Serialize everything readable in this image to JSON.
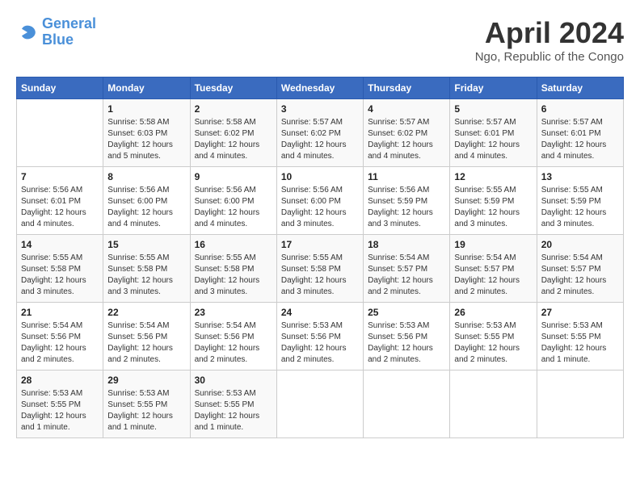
{
  "logo": {
    "line1": "General",
    "line2": "Blue"
  },
  "title": "April 2024",
  "subtitle": "Ngo, Republic of the Congo",
  "days_of_week": [
    "Sunday",
    "Monday",
    "Tuesday",
    "Wednesday",
    "Thursday",
    "Friday",
    "Saturday"
  ],
  "weeks": [
    [
      {
        "num": "",
        "detail": ""
      },
      {
        "num": "1",
        "detail": "Sunrise: 5:58 AM\nSunset: 6:03 PM\nDaylight: 12 hours\nand 5 minutes."
      },
      {
        "num": "2",
        "detail": "Sunrise: 5:58 AM\nSunset: 6:02 PM\nDaylight: 12 hours\nand 4 minutes."
      },
      {
        "num": "3",
        "detail": "Sunrise: 5:57 AM\nSunset: 6:02 PM\nDaylight: 12 hours\nand 4 minutes."
      },
      {
        "num": "4",
        "detail": "Sunrise: 5:57 AM\nSunset: 6:02 PM\nDaylight: 12 hours\nand 4 minutes."
      },
      {
        "num": "5",
        "detail": "Sunrise: 5:57 AM\nSunset: 6:01 PM\nDaylight: 12 hours\nand 4 minutes."
      },
      {
        "num": "6",
        "detail": "Sunrise: 5:57 AM\nSunset: 6:01 PM\nDaylight: 12 hours\nand 4 minutes."
      }
    ],
    [
      {
        "num": "7",
        "detail": "Sunrise: 5:56 AM\nSunset: 6:01 PM\nDaylight: 12 hours\nand 4 minutes."
      },
      {
        "num": "8",
        "detail": "Sunrise: 5:56 AM\nSunset: 6:00 PM\nDaylight: 12 hours\nand 4 minutes."
      },
      {
        "num": "9",
        "detail": "Sunrise: 5:56 AM\nSunset: 6:00 PM\nDaylight: 12 hours\nand 4 minutes."
      },
      {
        "num": "10",
        "detail": "Sunrise: 5:56 AM\nSunset: 6:00 PM\nDaylight: 12 hours\nand 3 minutes."
      },
      {
        "num": "11",
        "detail": "Sunrise: 5:56 AM\nSunset: 5:59 PM\nDaylight: 12 hours\nand 3 minutes."
      },
      {
        "num": "12",
        "detail": "Sunrise: 5:55 AM\nSunset: 5:59 PM\nDaylight: 12 hours\nand 3 minutes."
      },
      {
        "num": "13",
        "detail": "Sunrise: 5:55 AM\nSunset: 5:59 PM\nDaylight: 12 hours\nand 3 minutes."
      }
    ],
    [
      {
        "num": "14",
        "detail": "Sunrise: 5:55 AM\nSunset: 5:58 PM\nDaylight: 12 hours\nand 3 minutes."
      },
      {
        "num": "15",
        "detail": "Sunrise: 5:55 AM\nSunset: 5:58 PM\nDaylight: 12 hours\nand 3 minutes."
      },
      {
        "num": "16",
        "detail": "Sunrise: 5:55 AM\nSunset: 5:58 PM\nDaylight: 12 hours\nand 3 minutes."
      },
      {
        "num": "17",
        "detail": "Sunrise: 5:55 AM\nSunset: 5:58 PM\nDaylight: 12 hours\nand 3 minutes."
      },
      {
        "num": "18",
        "detail": "Sunrise: 5:54 AM\nSunset: 5:57 PM\nDaylight: 12 hours\nand 2 minutes."
      },
      {
        "num": "19",
        "detail": "Sunrise: 5:54 AM\nSunset: 5:57 PM\nDaylight: 12 hours\nand 2 minutes."
      },
      {
        "num": "20",
        "detail": "Sunrise: 5:54 AM\nSunset: 5:57 PM\nDaylight: 12 hours\nand 2 minutes."
      }
    ],
    [
      {
        "num": "21",
        "detail": "Sunrise: 5:54 AM\nSunset: 5:56 PM\nDaylight: 12 hours\nand 2 minutes."
      },
      {
        "num": "22",
        "detail": "Sunrise: 5:54 AM\nSunset: 5:56 PM\nDaylight: 12 hours\nand 2 minutes."
      },
      {
        "num": "23",
        "detail": "Sunrise: 5:54 AM\nSunset: 5:56 PM\nDaylight: 12 hours\nand 2 minutes."
      },
      {
        "num": "24",
        "detail": "Sunrise: 5:53 AM\nSunset: 5:56 PM\nDaylight: 12 hours\nand 2 minutes."
      },
      {
        "num": "25",
        "detail": "Sunrise: 5:53 AM\nSunset: 5:56 PM\nDaylight: 12 hours\nand 2 minutes."
      },
      {
        "num": "26",
        "detail": "Sunrise: 5:53 AM\nSunset: 5:55 PM\nDaylight: 12 hours\nand 2 minutes."
      },
      {
        "num": "27",
        "detail": "Sunrise: 5:53 AM\nSunset: 5:55 PM\nDaylight: 12 hours\nand 1 minute."
      }
    ],
    [
      {
        "num": "28",
        "detail": "Sunrise: 5:53 AM\nSunset: 5:55 PM\nDaylight: 12 hours\nand 1 minute."
      },
      {
        "num": "29",
        "detail": "Sunrise: 5:53 AM\nSunset: 5:55 PM\nDaylight: 12 hours\nand 1 minute."
      },
      {
        "num": "30",
        "detail": "Sunrise: 5:53 AM\nSunset: 5:55 PM\nDaylight: 12 hours\nand 1 minute."
      },
      {
        "num": "",
        "detail": ""
      },
      {
        "num": "",
        "detail": ""
      },
      {
        "num": "",
        "detail": ""
      },
      {
        "num": "",
        "detail": ""
      }
    ]
  ]
}
